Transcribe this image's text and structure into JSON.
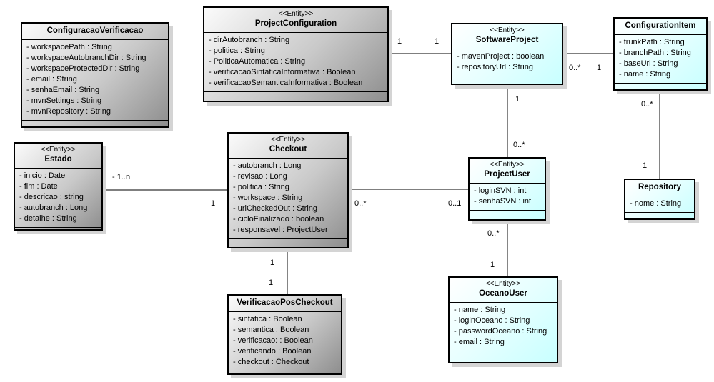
{
  "classes": [
    {
      "id": "configuracao-verificacao",
      "stereotype": "",
      "name": "ConfiguracaoVerificacao",
      "style": "gray",
      "attributes": [
        "- workspacePath : String",
        "- workspaceAutobranchDir : String",
        "- workspaceProtectedDir : String",
        "- email : String",
        "- senhaEmail : String",
        "- mvnSettings : String",
        "- mvnRepository : String"
      ]
    },
    {
      "id": "project-configuration",
      "stereotype": "<<Entity>>",
      "name": "ProjectConfiguration",
      "style": "gray",
      "attributes": [
        "- dirAutobranch : String",
        "- politica : String",
        "- PoliticaAutomatica : String",
        "- verificacaoSintaticaInformativa : Boolean",
        "- verificacaoSemanticaInformativa : Boolean"
      ]
    },
    {
      "id": "software-project",
      "stereotype": "<<Entity>>",
      "name": "SoftwareProject",
      "style": "cyan",
      "attributes": [
        "- mavenProject : boolean",
        "- repositoryUrl : String"
      ]
    },
    {
      "id": "configuration-item",
      "stereotype": "",
      "name": "ConfigurationItem",
      "style": "cyan",
      "attributes": [
        "- trunkPath : String",
        "- branchPath : String",
        "- baseUrl : String",
        "- name : String"
      ]
    },
    {
      "id": "repository",
      "stereotype": "",
      "name": "Repository",
      "style": "cyan",
      "attributes": [
        "- nome : String"
      ]
    },
    {
      "id": "estado",
      "stereotype": "<<Entity>>",
      "name": "Estado",
      "style": "gray",
      "attributes": [
        "- inicio : Date",
        "- fim : Date",
        "- descricao : string",
        "- autobranch : Long",
        "- detalhe : String"
      ]
    },
    {
      "id": "checkout",
      "stereotype": "<<Entity>>",
      "name": "Checkout",
      "style": "gray",
      "attributes": [
        "- autobranch : Long",
        "- revisao : Long",
        "- politica : String",
        "- workspace : String",
        "- urlCheckedOut : String",
        "- cicloFinalizado : boolean",
        "- responsavel : ProjectUser"
      ]
    },
    {
      "id": "project-user",
      "stereotype": "<<Entity>>",
      "name": "ProjectUser",
      "style": "cyan",
      "attributes": [
        "- loginSVN : int",
        "- senhaSVN : int"
      ]
    },
    {
      "id": "verificacao-pos-checkout",
      "stereotype": "",
      "name": "VerificacaoPosCheckout",
      "style": "gray",
      "attributes": [
        "- sintatica : Boolean",
        "- semantica : Boolean",
        "- verificacao: : Boolean",
        "- verificando : Boolean",
        "- checkout : Checkout"
      ]
    },
    {
      "id": "oceano-user",
      "stereotype": "<<Entity>>",
      "name": "OceanoUser",
      "style": "cyan",
      "attributes": [
        "- name : String",
        "- loginOceano : String",
        "- passwordOceano : String",
        "- email : String"
      ]
    }
  ],
  "associations": [
    {
      "from": "project-configuration",
      "to": "software-project",
      "from_mult": "1",
      "to_mult": "1"
    },
    {
      "from": "software-project",
      "to": "configuration-item",
      "from_mult": "0..*",
      "to_mult": "1"
    },
    {
      "from": "software-project",
      "to": "project-user",
      "from_mult": "1",
      "to_mult": "0..*"
    },
    {
      "from": "configuration-item",
      "to": "repository",
      "from_mult": "0..*",
      "to_mult": "1"
    },
    {
      "from": "estado",
      "to": "checkout",
      "from_mult": "- 1..n",
      "to_mult": "1"
    },
    {
      "from": "checkout",
      "to": "project-user",
      "from_mult": "0..*",
      "to_mult": "0..1"
    },
    {
      "from": "checkout",
      "to": "verificacao-pos-checkout",
      "from_mult": "1",
      "to_mult": "1"
    },
    {
      "from": "project-user",
      "to": "oceano-user",
      "from_mult": "0..*",
      "to_mult": "1"
    }
  ]
}
